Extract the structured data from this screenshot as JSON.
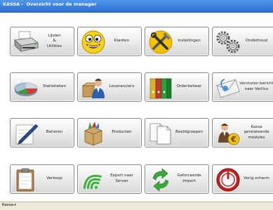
{
  "window": {
    "title": "KASSA -  Overzicht voor de manager"
  },
  "status": {
    "text": "Kassa+"
  },
  "tiles": [
    {
      "label": "Lijsten\n&\nUtilities",
      "icon": "printer-icon"
    },
    {
      "label": "Klanten",
      "icon": "smiley-icon"
    },
    {
      "label": "Instellingen",
      "icon": "tools-icon"
    },
    {
      "label": "Onderhoud",
      "icon": "gears-icon"
    },
    {
      "label": "Statistieken",
      "icon": "pie-chart-icon"
    },
    {
      "label": "Leveranciers",
      "icon": "supplier-icon"
    },
    {
      "label": "Orderbeheer",
      "icon": "binders-icon"
    },
    {
      "label": "Versturen bericht\nnaar Vertico",
      "icon": "mail-icon"
    },
    {
      "label": "Beheren",
      "icon": "pen-paper-icon"
    },
    {
      "label": "Producten",
      "icon": "box-icon"
    },
    {
      "label": "Beeldgroepen",
      "icon": "documents-icon"
    },
    {
      "label": "Kassa\ngerelateerde\nmodules",
      "icon": "user-euro-icon"
    },
    {
      "label": "Verkoop",
      "icon": "clipboard-icon"
    },
    {
      "label": "Export naar Server",
      "icon": "wifi-icon"
    },
    {
      "label": "Geforceerde\nimport",
      "icon": "refresh-arrows-icon"
    },
    {
      "label": "Vorig scherm",
      "icon": "power-icon"
    }
  ]
}
